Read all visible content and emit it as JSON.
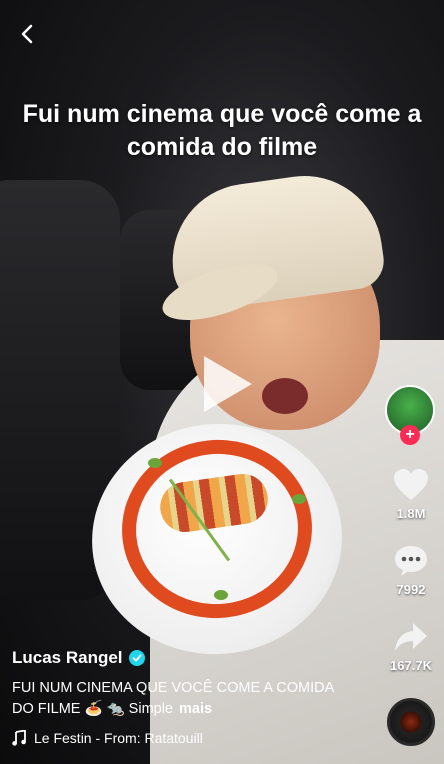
{
  "overlay": {
    "caption": "Fui num cinema que você come a comida do filme"
  },
  "actions": {
    "likes": "1.8M",
    "comments": "7992",
    "shares": "167.7K"
  },
  "post": {
    "author": "Lucas Rangel",
    "description": "FUI NUM CINEMA QUE VOCÊ COME A COMIDA DO FILME 🍝 🐀 Simple",
    "more_label": "mais"
  },
  "music": {
    "title": "Le Festin - From: Ratatouill"
  },
  "icons": {
    "back": "chevron-left-icon",
    "play": "play-icon",
    "like": "heart-icon",
    "comment": "comment-bubble-icon",
    "share": "share-arrow-icon",
    "music": "music-note-icon",
    "follow": "plus-icon",
    "verified": "checkmark-icon"
  },
  "colors": {
    "follow": "#fe2c55",
    "verified": "#20d5ec",
    "sauce": "#e04a1f"
  }
}
